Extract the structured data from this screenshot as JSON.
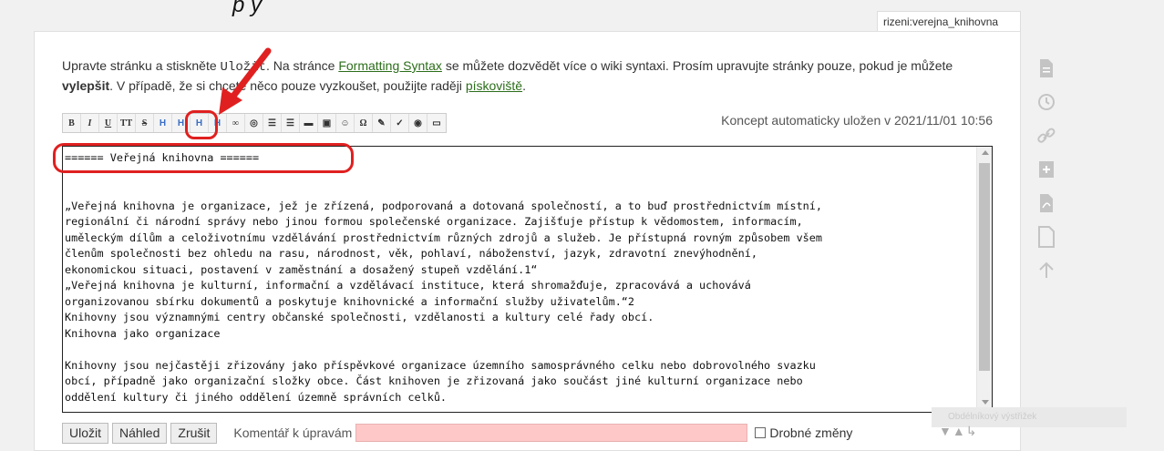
{
  "top_cut_text": "p                y",
  "page_name": "rizeni:verejna_knihovna",
  "intro": {
    "part1": "Upravte stránku a stiskněte ",
    "save_word": "Uložit",
    "part2": ". Na stránce ",
    "formatting_link": "Formatting Syntax",
    "part3": " se můžete dozvědět více o wiki syntaxi. Prosím upravujte stránky pouze, pokud je můžete ",
    "improve_word": "vylepšit",
    "part4": ". V případě, že si chcete něco pouze vyzkoušet, použijte raději ",
    "sandbox_link": "pískoviště",
    "part5": "."
  },
  "toolbar": {
    "buttons": [
      {
        "name": "bold-button",
        "label": "B"
      },
      {
        "name": "italic-button",
        "label": "I"
      },
      {
        "name": "underline-button",
        "label": "U"
      },
      {
        "name": "monospace-button",
        "label": "TT"
      },
      {
        "name": "strike-button",
        "label": "S"
      },
      {
        "name": "same-level-heading-button",
        "label": "H"
      },
      {
        "name": "lower-heading-button",
        "label": "H"
      },
      {
        "name": "higher-heading-button",
        "label": "H"
      },
      {
        "name": "select-heading-button",
        "label": "H"
      },
      {
        "name": "internal-link-button",
        "label": "∞"
      },
      {
        "name": "external-link-button",
        "label": "◎"
      },
      {
        "name": "ordered-list-button",
        "label": "☰"
      },
      {
        "name": "unordered-list-button",
        "label": "☰"
      },
      {
        "name": "horizontal-rule-button",
        "label": "▬"
      },
      {
        "name": "media-button",
        "label": "▣"
      },
      {
        "name": "smileys-button",
        "label": "☺"
      },
      {
        "name": "special-chars-button",
        "label": "Ω"
      },
      {
        "name": "plugin-button-1",
        "label": "✎"
      },
      {
        "name": "plugin-button-2",
        "label": "✓"
      },
      {
        "name": "plugin-button-3",
        "label": "◉"
      },
      {
        "name": "signature-button",
        "label": "▭"
      }
    ]
  },
  "autosave_text": "Koncept automaticky uložen v 2021/11/01 10:56",
  "editor": {
    "lines": [
      "====== Veřejná knihovna ======",
      "",
      "",
      "„Veřejná knihovna je organizace, jež je zřízená, podporovaná a dotovaná společností, a to buď prostřednictvím místní,",
      "regionální či národní správy nebo jinou formou společenské organizace. Zajišťuje přístup k vědomostem, informacím,",
      "uměleckým dílům a celoživotnímu vzdělávání prostřednictvím různých zdrojů a služeb. Je přístupná rovným způsobem všem",
      "členům společnosti bez ohledu na rasu, národnost, věk, pohlaví, náboženství, jazyk, zdravotní znevýhodnění,",
      "ekonomickou situaci, postavení v zaměstnání a dosažený stupeň vzdělání.1“",
      "„Veřejná knihovna je kulturní, informační a vzdělávací instituce, která shromažďuje, zpracovává a uchovává",
      "organizovanou sbírku dokumentů a poskytuje knihovnické a informační služby uživatelům.“2",
      "Knihovny jsou významnými centry občanské společnosti, vzdělanosti a kultury celé řady obcí.",
      "Knihovna jako organizace",
      "",
      "Knihovny jsou nejčastěji zřizovány jako příspěvkové organizace územního samosprávného celku nebo dobrovolného svazku",
      "obcí, případně jako organizační složky obce. Část knihoven je zřizovaná jako součást jiné kulturní organizace nebo",
      "oddělení kultury či jiného oddělení územně správních celků."
    ]
  },
  "bottom": {
    "save_label": "Uložit",
    "preview_label": "Náhled",
    "cancel_label": "Zrušit",
    "summary_label": "Komentář k úpravám",
    "minor_label": "Drobné změny"
  },
  "snip_text": "Obdélníkový výstřižek",
  "colors": {
    "link": "#2b6e1a",
    "annotation_red": "#e02020",
    "summary_bg": "#ffc8c8"
  }
}
